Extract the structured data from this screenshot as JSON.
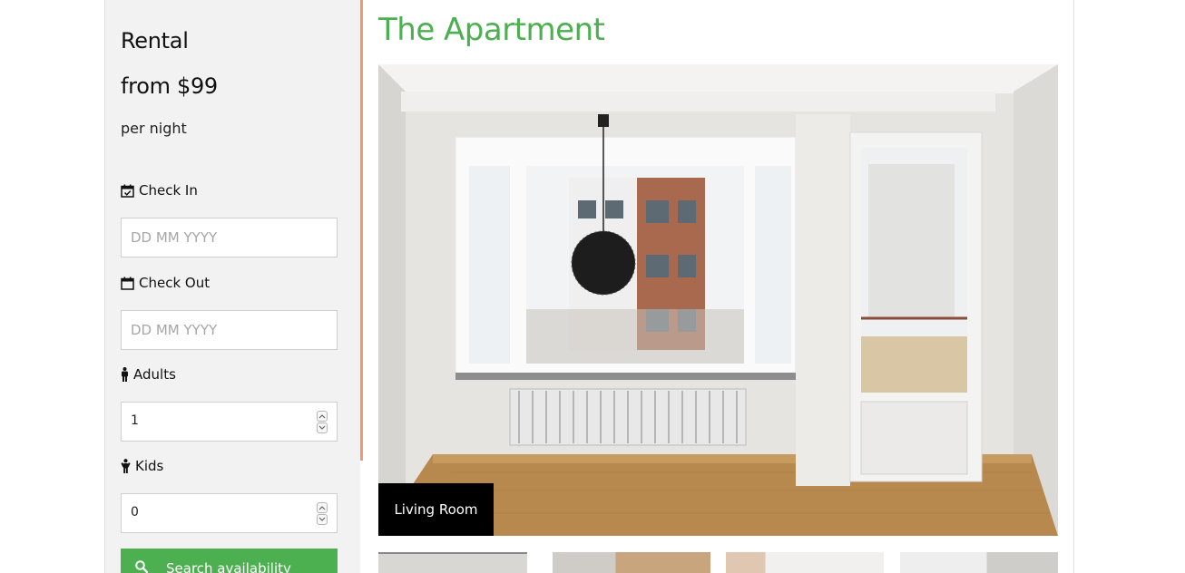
{
  "sidebar": {
    "price_label": "Rental",
    "price_value": "from $99",
    "price_unit": "per night",
    "check_in": {
      "label": "Check In",
      "placeholder": "DD MM YYYY",
      "icon": "calendar-check-icon"
    },
    "check_out": {
      "label": "Check Out",
      "placeholder": "DD MM YYYY",
      "icon": "calendar-icon"
    },
    "adults": {
      "label": "Adults",
      "value": "1",
      "icon": "male-icon"
    },
    "kids": {
      "label": "Kids",
      "value": "0",
      "icon": "child-icon"
    },
    "search_button": {
      "label": "Search availability",
      "icon": "search-icon"
    }
  },
  "main": {
    "title": "The Apartment",
    "gallery": {
      "caption": "Living Room"
    }
  },
  "colors": {
    "accent_green": "#4caf50",
    "sidebar_bg": "#f2f2f2",
    "accent_orange": "#ee9a74",
    "caption_bg": "#000000"
  }
}
